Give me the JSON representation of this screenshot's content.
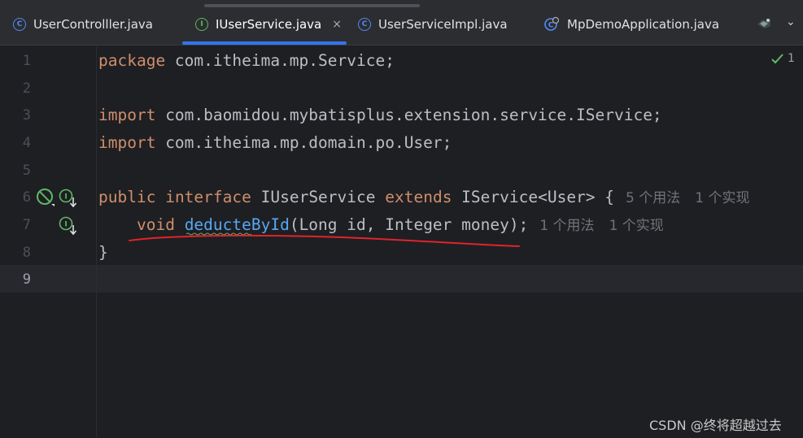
{
  "tabs": [
    {
      "label": "UserControlller.java",
      "icon": "class-icon",
      "active": false
    },
    {
      "label": "IUserService.java",
      "icon": "interface-icon",
      "active": true,
      "closable": true
    },
    {
      "label": "UserServiceImpl.java",
      "icon": "class-icon",
      "active": false
    },
    {
      "label": "MpDemoApplication.java",
      "icon": "spring-boot-app-icon",
      "active": false
    }
  ],
  "close_glyph": "×",
  "tab_overflow_glyph": "⌄",
  "inspection": {
    "icon": "check-icon",
    "count": "1"
  },
  "editor": {
    "line_numbers": [
      "1",
      "2",
      "3",
      "4",
      "5",
      "6",
      "7",
      "8",
      "9"
    ],
    "current_line": "9",
    "lines": {
      "l1": {
        "kw": "package",
        "rest": " com.itheima.mp.Service;"
      },
      "l3": {
        "kw": "import",
        "rest": " com.baomidou.mybatisplus.extension.service.IService;"
      },
      "l4": {
        "kw": "import",
        "rest": " com.itheima.mp.domain.po.User;"
      },
      "l6": {
        "kw1": "public",
        "kw2": "interface",
        "name": " IUserService ",
        "kw3": "extends",
        "rest": " IService<User> {",
        "hint_usages": "5 个用法",
        "hint_impls": "1 个实现"
      },
      "l7": {
        "indent": "    ",
        "kw": "void",
        "method": "deducteById",
        "params": "(Long id, Integer money);",
        "hint_usages": "1 个用法",
        "hint_impls": "1 个实现"
      },
      "l8": {
        "text": "}"
      }
    }
  },
  "annotation_color": "#e0242a",
  "watermark": "CSDN @终将超越过去"
}
